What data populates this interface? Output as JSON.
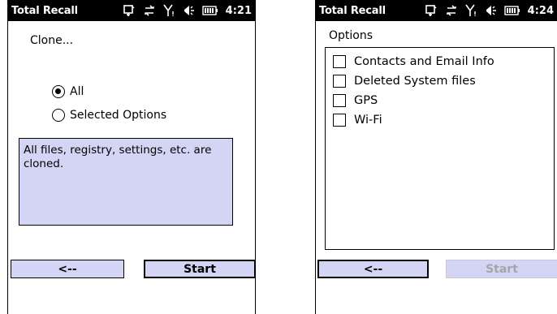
{
  "left_screen": {
    "status_bar": {
      "app_title": "Total Recall",
      "time": "4:21"
    },
    "heading": "Clone...",
    "radio_options": [
      {
        "label": "All",
        "selected": true
      },
      {
        "label": "Selected Options",
        "selected": false
      }
    ],
    "description": "All files, registry, settings, etc. are cloned.",
    "buttons": {
      "back_label": "<--",
      "start_label": "Start"
    }
  },
  "right_screen": {
    "status_bar": {
      "app_title": "Total Recall",
      "time": "4:24"
    },
    "heading": "Options",
    "options": [
      {
        "label": "Contacts and Email Info",
        "checked": false
      },
      {
        "label": "Deleted System files",
        "checked": false
      },
      {
        "label": "GPS",
        "checked": false
      },
      {
        "label": "Wi-Fi",
        "checked": false
      }
    ],
    "buttons": {
      "back_label": "<--",
      "start_label": "Start"
    }
  },
  "icons": [
    "sync-icon",
    "data-connection-icon",
    "signal-strength-icon",
    "volume-icon",
    "battery-icon"
  ],
  "colors": {
    "titlebar": "#000000",
    "panel": "#d4d4f4",
    "disabled_text": "#a5a5a5"
  }
}
